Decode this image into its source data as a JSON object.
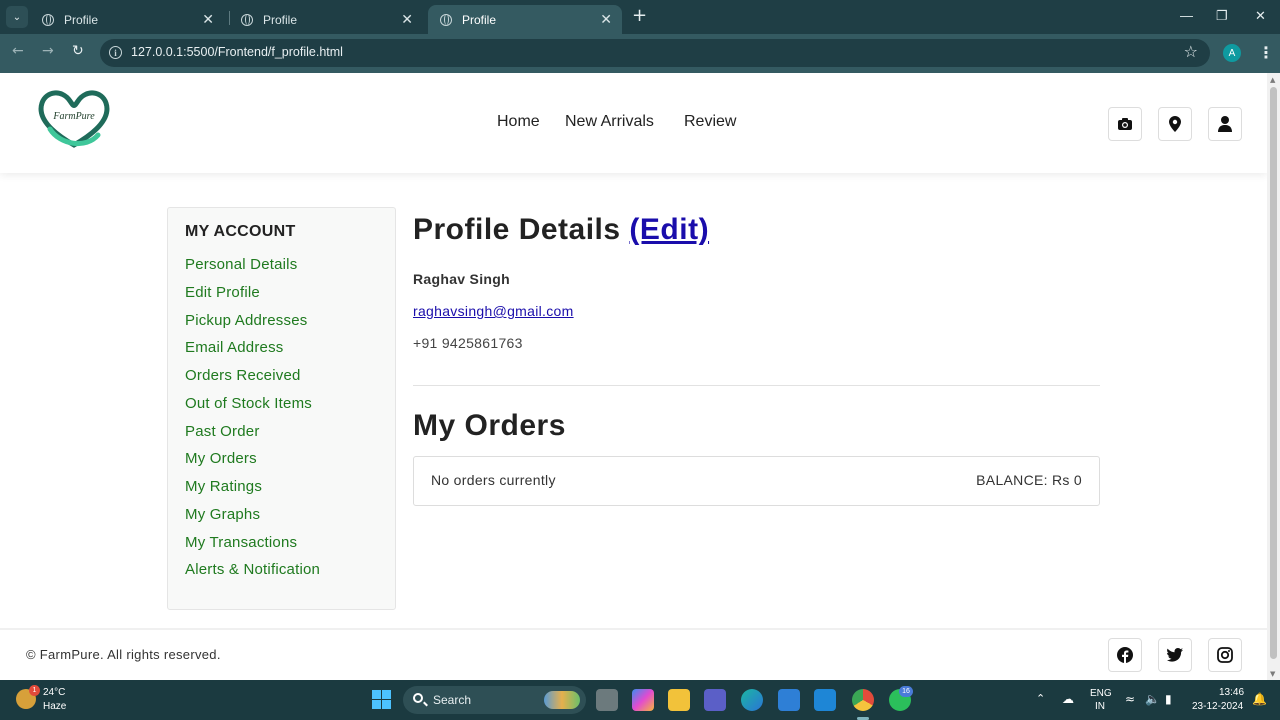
{
  "browser": {
    "tabs": [
      {
        "title": "Profile",
        "active": false
      },
      {
        "title": "Profile",
        "active": false
      },
      {
        "title": "Profile",
        "active": true
      }
    ],
    "url": "127.0.0.1:5500/Frontend/f_profile.html",
    "profile_initial": "A",
    "colors": {
      "tabbar": "#1f3e45",
      "toolbar": "#345a61"
    }
  },
  "site": {
    "nav": [
      "Home",
      "New Arrivals",
      "Review"
    ],
    "logo_text": "FarmPure",
    "header_icons": [
      "camera-icon",
      "map-pin-icon",
      "user-icon"
    ],
    "accent_color": "#1f7a1f"
  },
  "sidebar": {
    "heading": "MY ACCOUNT",
    "items": [
      "Personal Details",
      "Edit Profile",
      "Pickup Addresses",
      "Email Address",
      "Orders Received",
      "Out of Stock Items",
      "Past Order",
      "My Orders",
      "My Ratings",
      "My Graphs",
      "My Transactions",
      "Alerts & Notification"
    ]
  },
  "profile": {
    "title": "Profile Details",
    "edit_label": "(Edit)",
    "name": "Raghav Singh",
    "email": "raghavsingh@gmail.com",
    "phone": "+91 9425861763"
  },
  "orders": {
    "title": "My Orders",
    "empty_text": "No orders currently",
    "balance": "BALANCE: Rs 0"
  },
  "footer": {
    "copyright": "© FarmPure. All rights reserved.",
    "social_icons": [
      "facebook-icon",
      "twitter-icon",
      "instagram-icon"
    ]
  },
  "taskbar": {
    "weather_temp": "24°C",
    "weather_desc": "Haze",
    "weather_badge": "1",
    "search_label": "Search",
    "whatsapp_badge": "16",
    "lang_top": "ENG",
    "lang_bottom": "IN",
    "time": "13:46",
    "date": "23-12-2024"
  }
}
